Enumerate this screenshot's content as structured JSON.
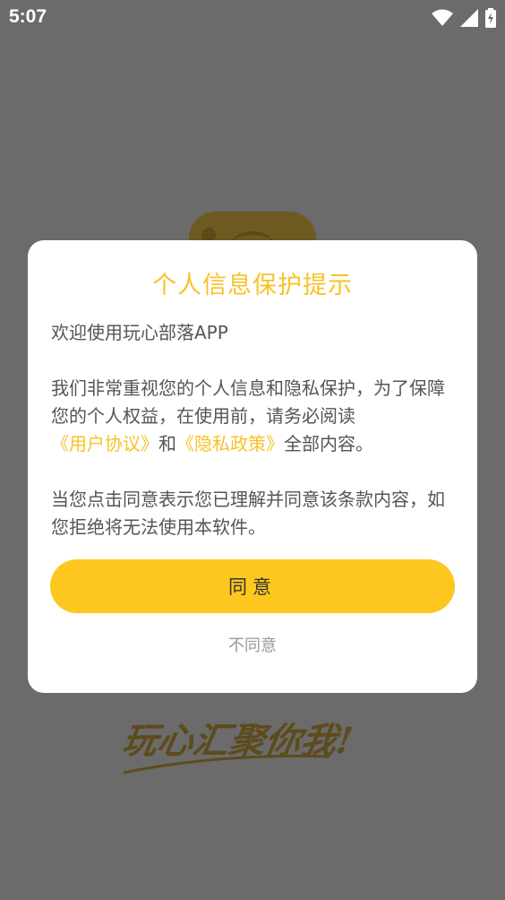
{
  "status_bar": {
    "time": "5:07"
  },
  "background": {
    "slogan": "玩心汇聚你我!"
  },
  "dialog": {
    "title": "个人信息保护提示",
    "welcome": "欢迎使用玩心部落APP",
    "para1_prefix": "我们非常重视您的个人信息和隐私保护，为了保障您的个人权益，在使用前，请务必阅读",
    "user_agreement_link": "《用户协议》",
    "and_text": "和",
    "privacy_policy_link": "《隐私政策》",
    "para1_suffix": "全部内容。",
    "para2": "当您点击同意表示您已理解并同意该条款内容，如您拒绝将无法使用本软件。",
    "agree_label": "同意",
    "disagree_label": "不同意"
  },
  "colors": {
    "accent": "#f7c228",
    "button": "#fdc71f",
    "overlay": "#6b6b6b"
  }
}
